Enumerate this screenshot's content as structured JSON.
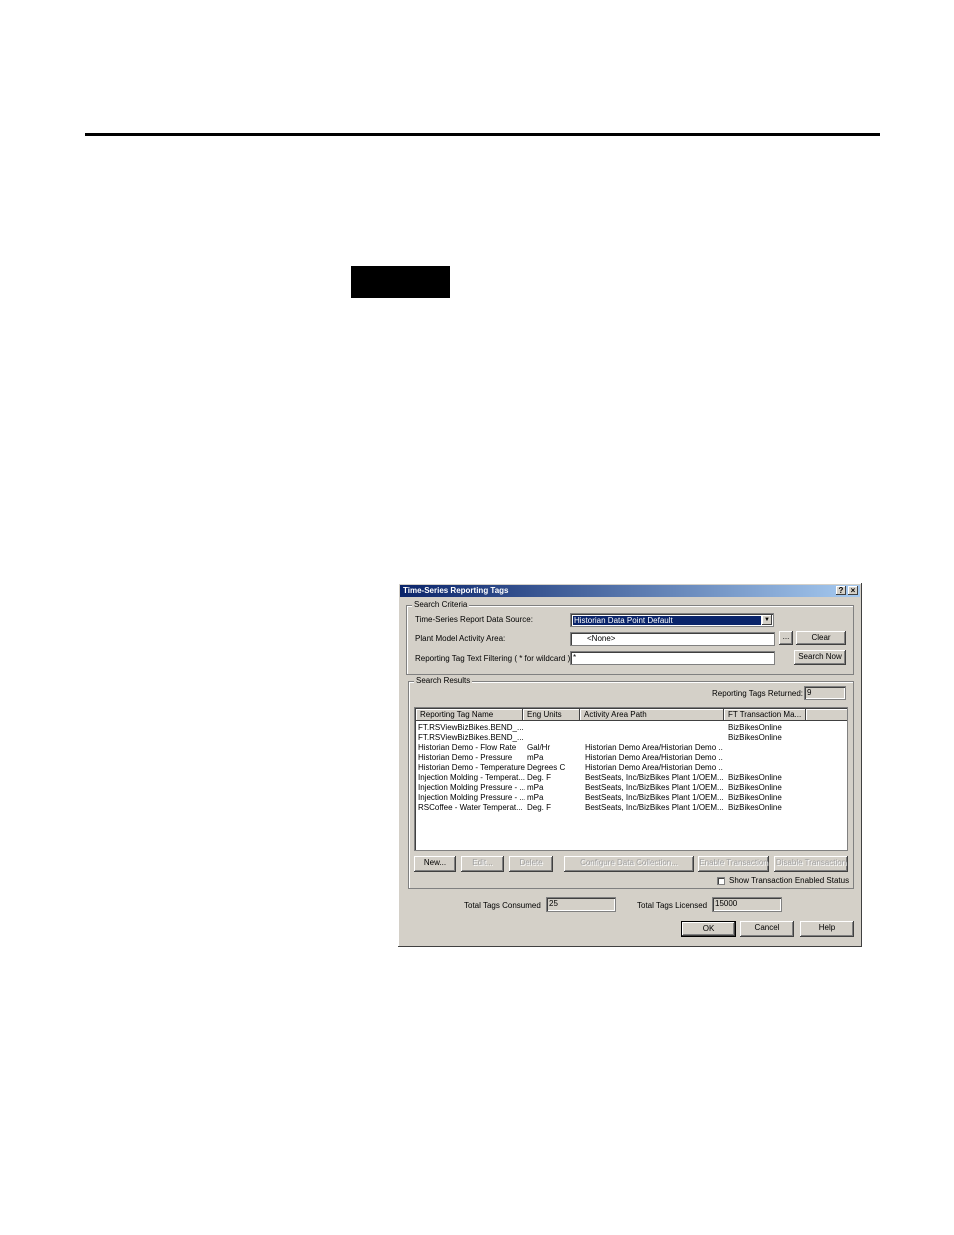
{
  "dialog": {
    "title": "Time-Series Reporting Tags",
    "help_btn": "?",
    "close_btn": "×",
    "search_criteria": {
      "label": "Search Criteria",
      "data_source_label": "Time-Series Report Data Source:",
      "data_source_value": "Historian Data Point Default",
      "activity_area_label": "Plant Model Activity Area:",
      "activity_area_value": "<None>",
      "browse_btn": "...",
      "clear_btn": "Clear",
      "filter_label": "Reporting Tag Text Filtering ( * for wildcard ):",
      "filter_value": "*",
      "search_btn": "Search Now"
    },
    "search_results": {
      "label": "Search Results",
      "returned_label": "Reporting Tags Returned:",
      "returned_value": "9",
      "columns": [
        "Reporting Tag Name",
        "Eng Units",
        "Activity Area Path",
        "FT Transaction Ma...",
        ""
      ],
      "rows": [
        [
          "FT.RSViewBizBikes.BEND_...",
          "",
          "",
          "BizBikesOnline"
        ],
        [
          "FT.RSViewBizBikes.BEND_...",
          "",
          "",
          "BizBikesOnline"
        ],
        [
          "Historian Demo - Flow Rate",
          "Gal/Hr",
          "Historian Demo Area/Historian Demo ...",
          ""
        ],
        [
          "Historian Demo - Pressure",
          "mPa",
          "Historian Demo Area/Historian Demo ...",
          ""
        ],
        [
          "Historian Demo - Temperature",
          "Degrees C",
          "Historian Demo Area/Historian Demo ...",
          ""
        ],
        [
          "Injection Molding - Temperat...",
          "Deg. F",
          "BestSeats, Inc/BizBikes Plant 1/OEM...",
          "BizBikesOnline"
        ],
        [
          "Injection Molding Pressure - ...",
          "mPa",
          "BestSeats, Inc/BizBikes Plant 1/OEM...",
          "BizBikesOnline"
        ],
        [
          "Injection Molding Pressure - ...",
          "mPa",
          "BestSeats, Inc/BizBikes Plant 1/OEM...",
          "BizBikesOnline"
        ],
        [
          "RSCoffee - Water Temperat...",
          "Deg. F",
          "BestSeats, Inc/BizBikes Plant 1/OEM...",
          "BizBikesOnline"
        ]
      ],
      "new_btn": "New...",
      "edit_btn": "Edit...",
      "delete_btn": "Delete",
      "configure_btn": "Configure Data Collection...",
      "enable_btn": "Enable Transaction",
      "disable_btn": "Disable Transaction",
      "show_status_label": "Show Transaction Enabled Status"
    },
    "totals": {
      "consumed_label": "Total Tags Consumed",
      "consumed_value": "25",
      "licensed_label": "Total Tags Licensed",
      "licensed_value": "15000"
    },
    "ok_btn": "OK",
    "cancel_btn": "Cancel",
    "help_button": "Help"
  }
}
